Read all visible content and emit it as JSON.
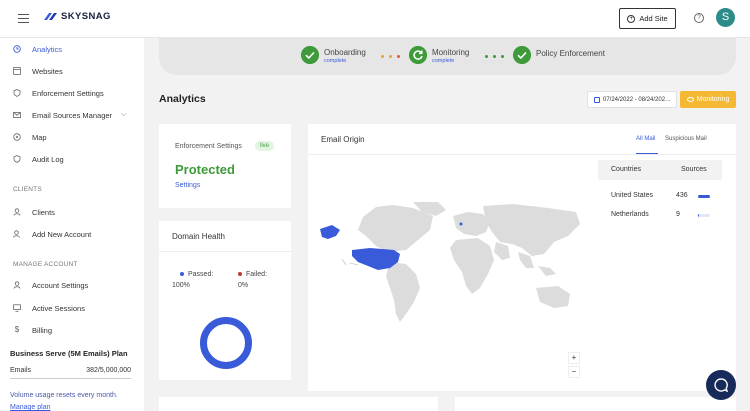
{
  "brand": {
    "name": "SKYSNAG",
    "color": "#3a5bd9"
  },
  "header": {
    "add_site_label": "Add Site",
    "avatar_letter": "S"
  },
  "sidebar": {
    "items": [
      {
        "label": "Analytics",
        "icon": "clock-icon",
        "active": true
      },
      {
        "label": "Websites",
        "icon": "browser-icon"
      },
      {
        "label": "Enforcement Settings",
        "icon": "shield-icon"
      },
      {
        "label": "Email Sources Manager",
        "icon": "mail-icon"
      },
      {
        "label": "Map",
        "icon": "map-pin-icon"
      },
      {
        "label": "Audit Log",
        "icon": "shield-icon"
      }
    ],
    "clients_section": "CLIENTS",
    "client_items": [
      {
        "label": "Clients",
        "icon": "person-icon"
      },
      {
        "label": "Add New Account",
        "icon": "person-add-icon"
      }
    ],
    "manage_section": "MANAGE ACCOUNT",
    "manage_items": [
      {
        "label": "Account Settings",
        "icon": "person-icon"
      },
      {
        "label": "Active Sessions",
        "icon": "monitor-icon"
      },
      {
        "label": "Billing",
        "icon": "dollar-icon"
      }
    ],
    "plan": {
      "title": "Business Serve (5M Emails) Plan",
      "emails_label": "Emails",
      "emails_value": "382/5,000,000",
      "note": "Volume usage resets every month.",
      "link": "Manage plan"
    }
  },
  "stepper": {
    "steps": [
      {
        "title": "Onboarding",
        "status": "complete"
      },
      {
        "title": "Monitoring",
        "status": "complete"
      },
      {
        "title": "Policy Enforcement",
        "status": ""
      }
    ]
  },
  "page": {
    "title": "Analytics",
    "date_range": "07/24/2022 - 08/24/202…",
    "monitoring_label": "Monitoring"
  },
  "enforcement": {
    "label": "Enforcement Settings",
    "badge": "live",
    "status": "Protected",
    "link": "Settings"
  },
  "domain_health": {
    "title": "Domain Health",
    "passed_label": "Passed:",
    "passed_value": "100%",
    "failed_label": "Failed:",
    "failed_value": "0%",
    "passed_color": "#3a5bd9",
    "failed_color": "#c0392b",
    "passed_fraction": 1.0
  },
  "email_origin": {
    "title": "Email Origin",
    "tabs": [
      "All Mail",
      "Suspicious Mail"
    ],
    "table_headers": [
      "Countries",
      "Sources"
    ],
    "rows": [
      {
        "country": "United States",
        "sources": "436",
        "fraction": 0.98
      },
      {
        "country": "Netherlands",
        "sources": "9",
        "fraction": 0.02
      }
    ],
    "zoom_in": "+",
    "zoom_out": "−"
  }
}
